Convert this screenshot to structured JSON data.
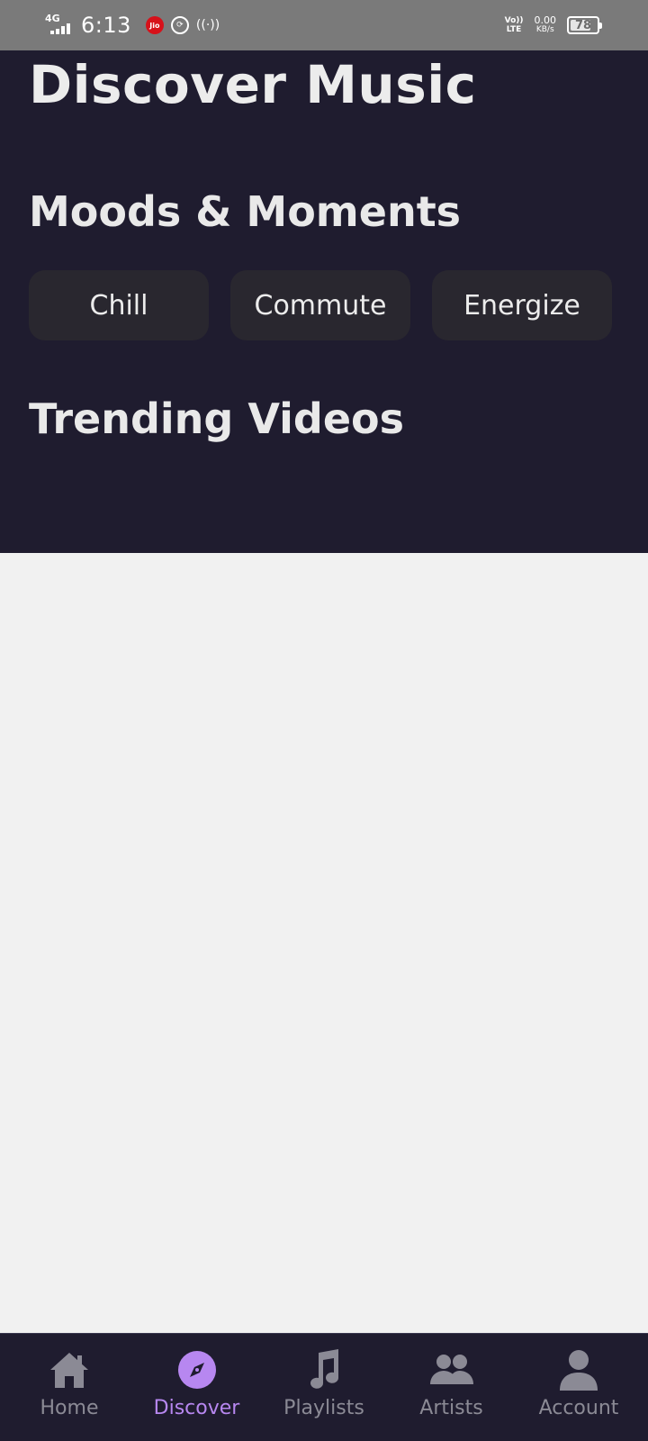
{
  "status_bar": {
    "network": "4G",
    "time": "6:13",
    "carrier_badge": "Jio",
    "volte_line1": "Vo))",
    "volte_line2": "LTE",
    "speed_value": "0.00",
    "speed_unit": "KB/s",
    "battery_level": "78"
  },
  "header": {
    "title": "Discover Music"
  },
  "moods": {
    "heading": "Moods & Moments",
    "chips": [
      "Chill",
      "Commute",
      "Energize"
    ]
  },
  "trending": {
    "heading": "Trending Videos"
  },
  "nav": {
    "items": [
      {
        "label": "Home",
        "icon": "home-icon"
      },
      {
        "label": "Discover",
        "icon": "compass-icon"
      },
      {
        "label": "Playlists",
        "icon": "music-note-icon"
      },
      {
        "label": "Artists",
        "icon": "people-icon"
      },
      {
        "label": "Account",
        "icon": "person-icon"
      }
    ],
    "active": "Discover",
    "active_color": "#b787f0",
    "inactive_color": "#8b8a95"
  },
  "colors": {
    "header_bg": "#1f1c2f",
    "content_bg": "#f1f1f1",
    "chip_bg": "#29272f"
  }
}
